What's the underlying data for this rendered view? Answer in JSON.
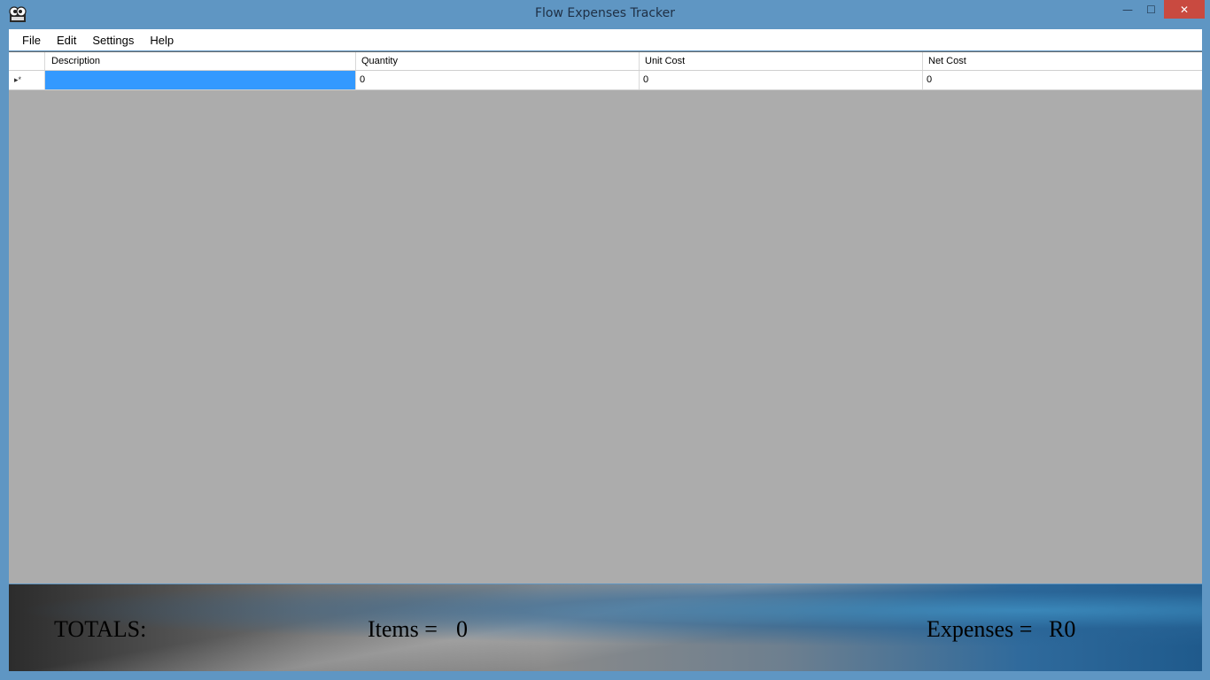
{
  "window": {
    "title": "Flow Expenses Tracker",
    "app_icon": "app-icon",
    "controls": {
      "minimize_glyph": "—",
      "maximize_glyph": "☐",
      "close_glyph": "✕"
    }
  },
  "menu": {
    "items": [
      {
        "label": "File"
      },
      {
        "label": "Edit"
      },
      {
        "label": "Settings"
      },
      {
        "label": "Help"
      }
    ]
  },
  "grid": {
    "columns": [
      "Description",
      "Quantity",
      "Unit Cost",
      "Net Cost"
    ],
    "rows": [
      {
        "marker": "▸*",
        "description": "",
        "quantity": "0",
        "unit_cost": "0",
        "net_cost": "0"
      }
    ],
    "selection_color": "#3399ff",
    "empty_area_color": "#acacac"
  },
  "totals": {
    "label": "TOTALS:",
    "items_label": "Items =",
    "items_value": "0",
    "expenses_label": "Expenses =",
    "expenses_value": "R0"
  },
  "colors": {
    "window_chrome": "#5f96c3",
    "close_button": "#c94a40"
  }
}
